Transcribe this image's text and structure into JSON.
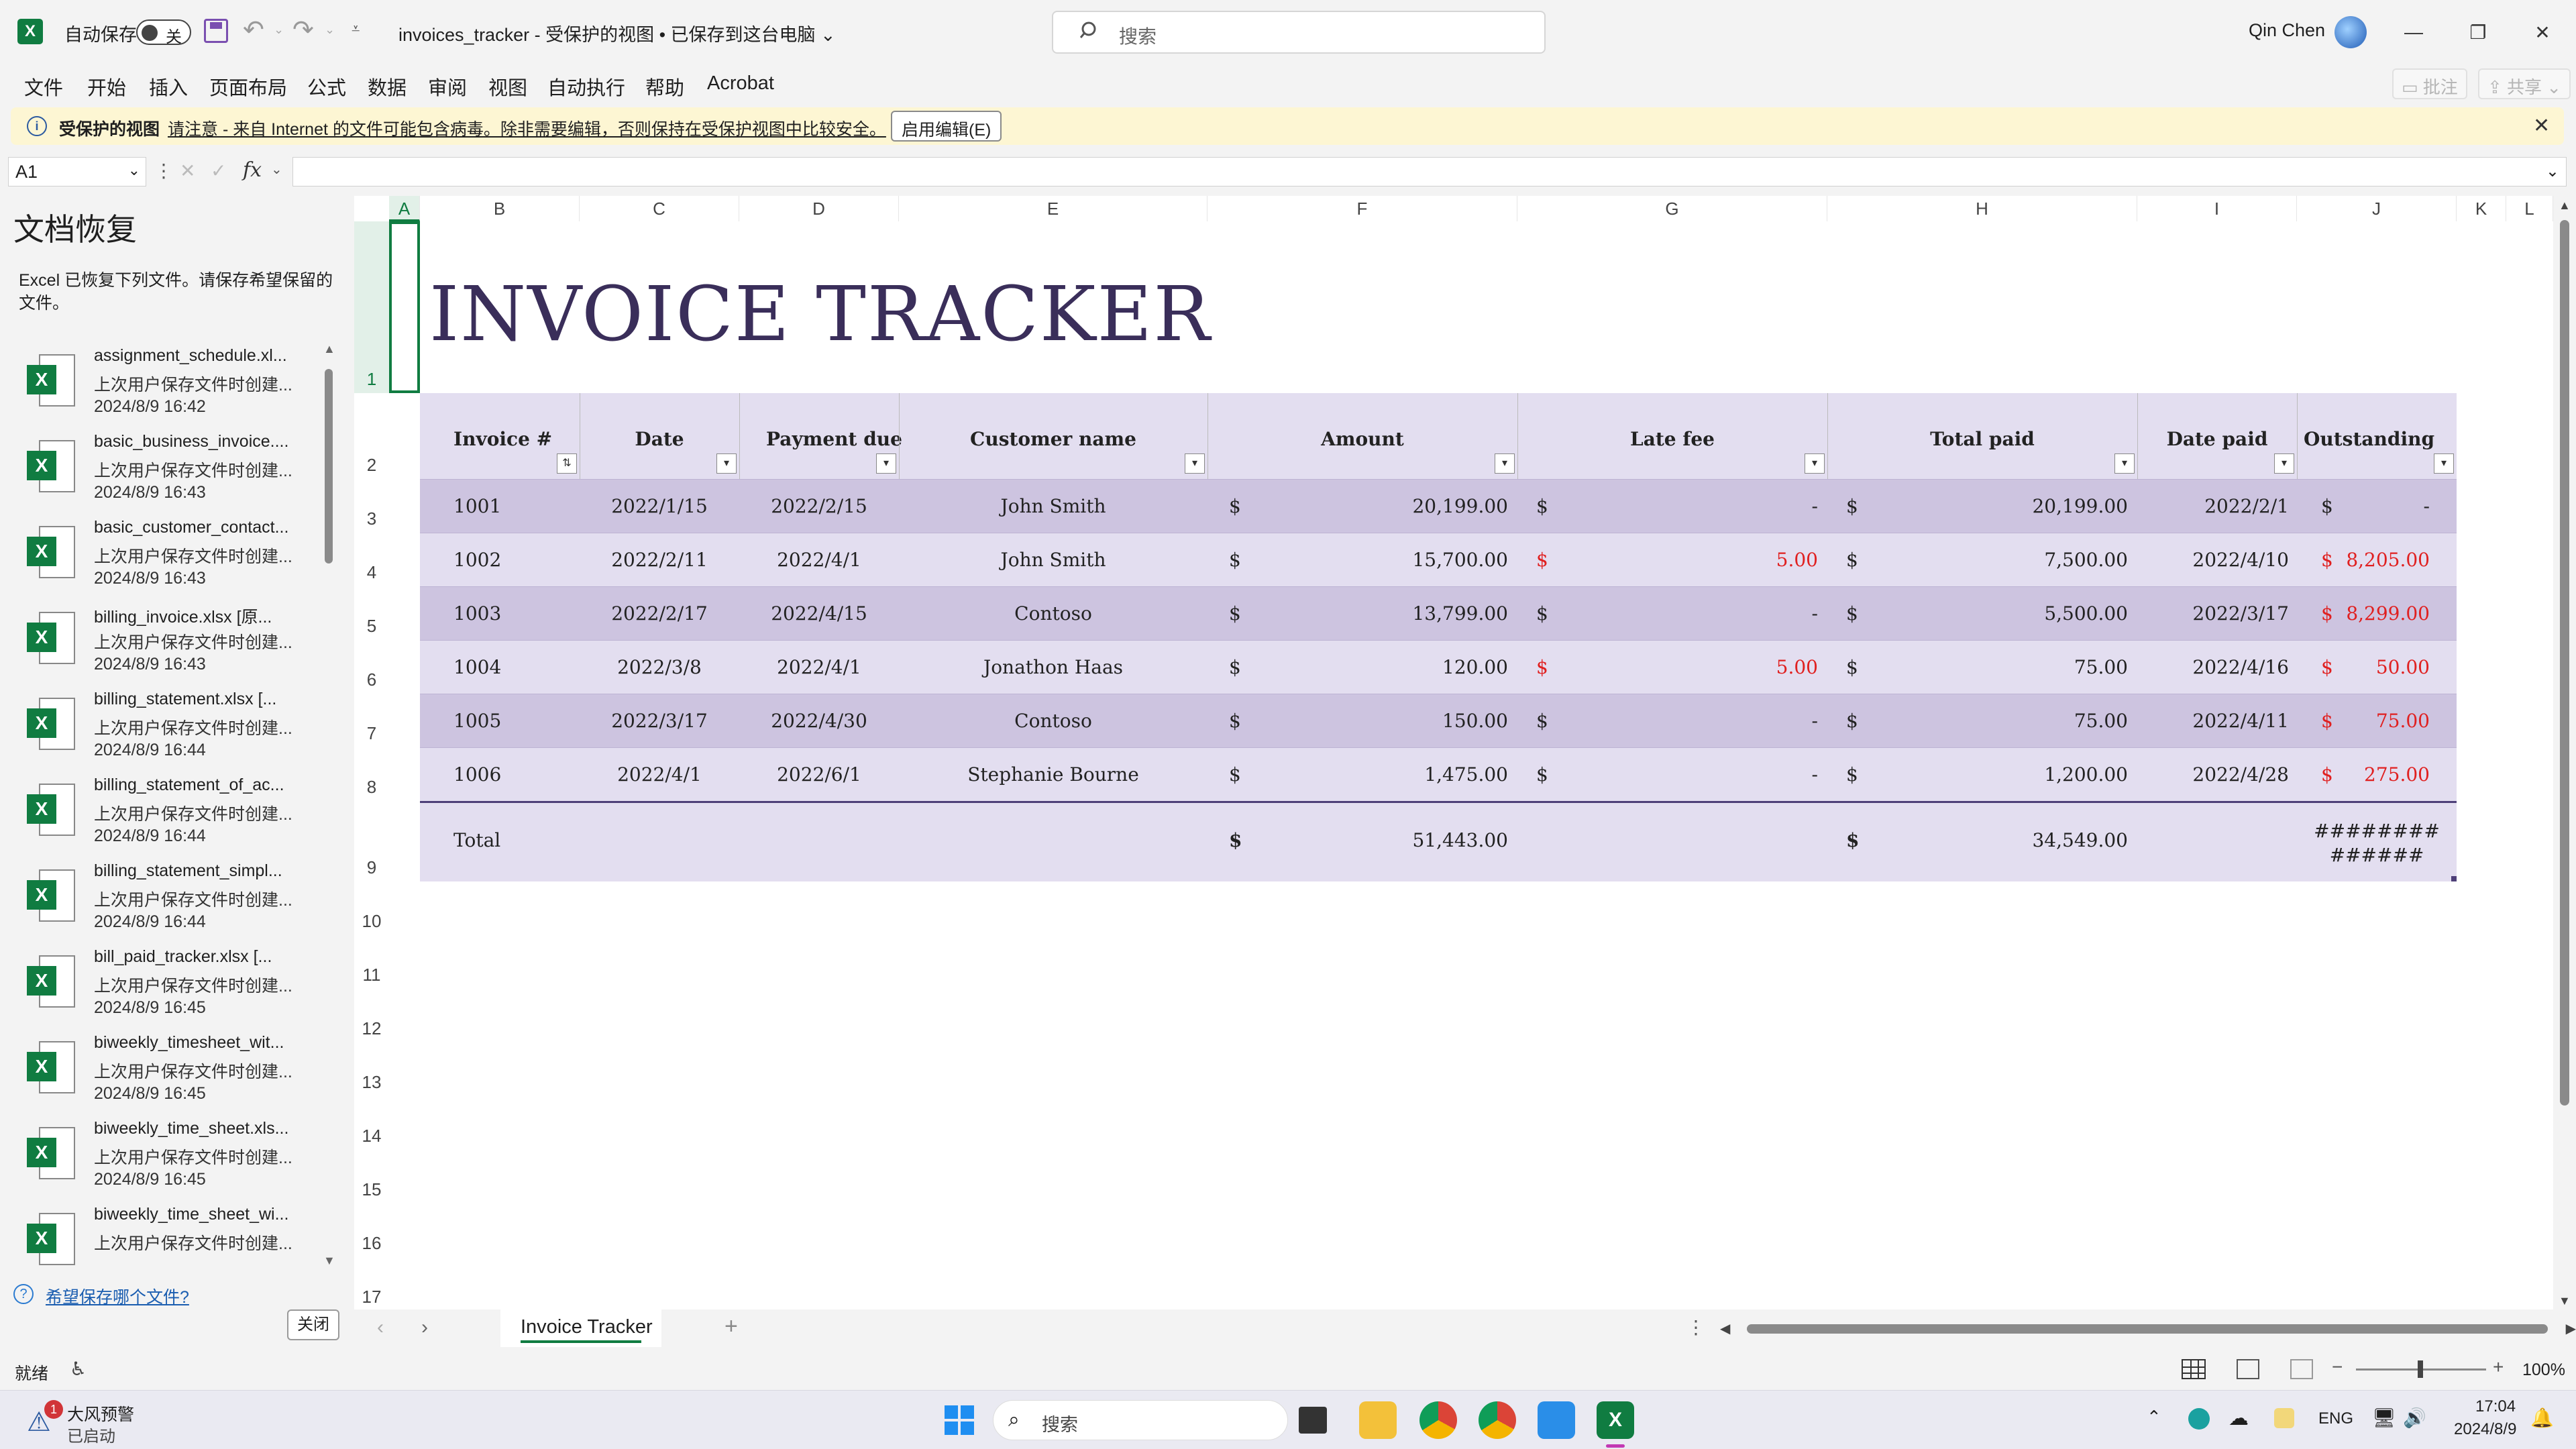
{
  "titlebar": {
    "autosave_label": "自动保存",
    "autosave_state": "关",
    "doc_title": "invoices_tracker  -  受保护的视图 • 已保存到这台电脑 ⌄",
    "search_placeholder": "搜索",
    "user_name": "Qin Chen"
  },
  "menu": [
    "文件",
    "开始",
    "插入",
    "页面布局",
    "公式",
    "数据",
    "审阅",
    "视图",
    "自动执行",
    "帮助",
    "Acrobat"
  ],
  "comment_btn": "批注",
  "share_btn": "共享",
  "protected": {
    "label": "受保护的视图",
    "message": "请注意 - 来自 Internet 的文件可能包含病毒。除非需要编辑，否则保持在受保护视图中比较安全。",
    "button": "启用编辑(E)"
  },
  "formula": {
    "cell_ref": "A1",
    "fx": "fx",
    "value": ""
  },
  "recovery": {
    "title": "文档恢复",
    "desc_line1": "Excel 已恢复下列文件。请保存希望保留的",
    "desc_line2": "文件。",
    "items": [
      {
        "name": "assignment_schedule.xl...",
        "sub": "上次用户保存文件时创建...",
        "time": "2024/8/9 16:42"
      },
      {
        "name": "basic_business_invoice....",
        "sub": "上次用户保存文件时创建...",
        "time": "2024/8/9 16:43"
      },
      {
        "name": "basic_customer_contact...",
        "sub": "上次用户保存文件时创建...",
        "time": "2024/8/9 16:43"
      },
      {
        "name": "billing_invoice.xlsx  [原...",
        "sub": "上次用户保存文件时创建...",
        "time": "2024/8/9 16:43"
      },
      {
        "name": "billing_statement.xlsx  [...",
        "sub": "上次用户保存文件时创建...",
        "time": "2024/8/9 16:44"
      },
      {
        "name": "billing_statement_of_ac...",
        "sub": "上次用户保存文件时创建...",
        "time": "2024/8/9 16:44"
      },
      {
        "name": "billing_statement_simpl...",
        "sub": "上次用户保存文件时创建...",
        "time": "2024/8/9 16:44"
      },
      {
        "name": "bill_paid_tracker.xlsx  [...",
        "sub": "上次用户保存文件时创建...",
        "time": "2024/8/9 16:45"
      },
      {
        "name": "biweekly_timesheet_wit...",
        "sub": "上次用户保存文件时创建...",
        "time": "2024/8/9 16:45"
      },
      {
        "name": "biweekly_time_sheet.xls...",
        "sub": "上次用户保存文件时创建...",
        "time": "2024/8/9 16:45"
      },
      {
        "name": "biweekly_time_sheet_wi...",
        "sub": "上次用户保存文件时创建...",
        "time": ""
      }
    ],
    "help_link": "希望保存哪个文件?",
    "close_btn": "关闭"
  },
  "columns": [
    "A",
    "B",
    "C",
    "D",
    "E",
    "F",
    "G",
    "H",
    "I",
    "J",
    "K",
    "L"
  ],
  "rows": [
    "1",
    "2",
    "3",
    "4",
    "5",
    "6",
    "7",
    "8",
    "9",
    "10",
    "11",
    "12",
    "13",
    "14",
    "15",
    "16",
    "17"
  ],
  "sheet": {
    "title": "INVOICE TRACKER",
    "headers": [
      "Invoice #",
      "Date",
      "Payment due",
      "Customer name",
      "Amount",
      "Late fee",
      "Total paid",
      "Date paid",
      "Outstanding"
    ],
    "records": [
      {
        "inv": "1001",
        "date": "2022/1/15",
        "due": "2022/2/15",
        "cust": "John Smith",
        "amount": "20,199.00",
        "late": "-",
        "late_red": false,
        "paid": "20,199.00",
        "date_paid": "2022/2/1",
        "outstanding": "-",
        "out_red": false
      },
      {
        "inv": "1002",
        "date": "2022/2/11",
        "due": "2022/4/1",
        "cust": "John Smith",
        "amount": "15,700.00",
        "late": "5.00",
        "late_red": true,
        "paid": "7,500.00",
        "date_paid": "2022/4/10",
        "outstanding": "8,205.00",
        "out_red": true
      },
      {
        "inv": "1003",
        "date": "2022/2/17",
        "due": "2022/4/15",
        "cust": "Contoso",
        "amount": "13,799.00",
        "late": "-",
        "late_red": false,
        "paid": "5,500.00",
        "date_paid": "2022/3/17",
        "outstanding": "8,299.00",
        "out_red": true
      },
      {
        "inv": "1004",
        "date": "2022/3/8",
        "due": "2022/4/1",
        "cust": "Jonathon Haas",
        "amount": "120.00",
        "late": "5.00",
        "late_red": true,
        "paid": "75.00",
        "date_paid": "2022/4/16",
        "outstanding": "50.00",
        "out_red": true
      },
      {
        "inv": "1005",
        "date": "2022/3/17",
        "due": "2022/4/30",
        "cust": "Contoso",
        "amount": "150.00",
        "late": "-",
        "late_red": false,
        "paid": "75.00",
        "date_paid": "2022/4/11",
        "outstanding": "75.00",
        "out_red": true
      },
      {
        "inv": "1006",
        "date": "2022/4/1",
        "due": "2022/6/1",
        "cust": "Stephanie Bourne",
        "amount": "1,475.00",
        "late": "-",
        "late_red": false,
        "paid": "1,200.00",
        "date_paid": "2022/4/28",
        "outstanding": "275.00",
        "out_red": true
      }
    ],
    "currency": "$",
    "total_label": "Total",
    "total_amount": "51,443.00",
    "total_paid": "34,549.00",
    "total_outstanding_l1": "########",
    "total_outstanding_l2": "######",
    "colors": {
      "row_dark": "#cdc4e0",
      "row_light": "#e3def0",
      "header_bg": "#e3def0",
      "title": "#3a2e5a"
    }
  },
  "sheet_tab": "Invoice Tracker",
  "status": {
    "ready": "就绪",
    "zoom": "100%"
  },
  "taskbar": {
    "weather_title": "大风预警",
    "weather_sub": "已启动",
    "weather_badge": "1",
    "search": "搜索",
    "lang": "ENG",
    "time": "17:04",
    "date": "2024/8/9"
  }
}
